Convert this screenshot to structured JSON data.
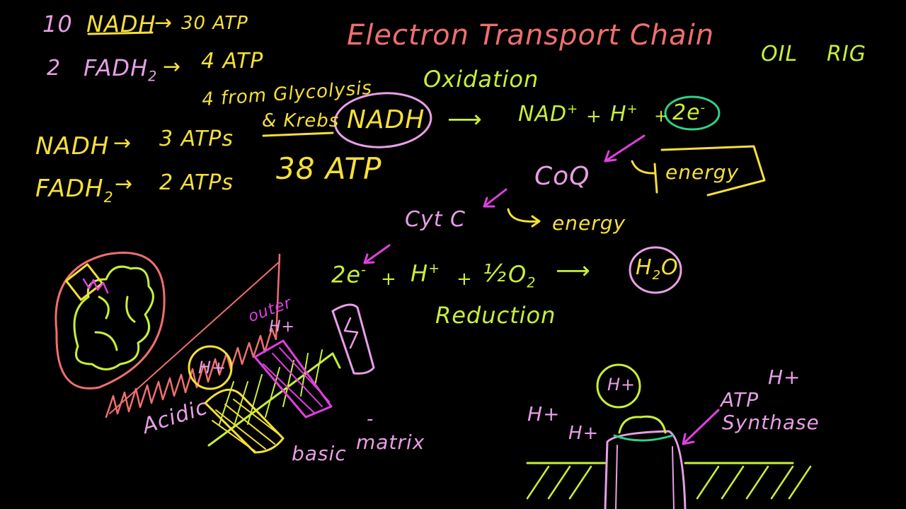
{
  "colors": {
    "yellow": "#f5e03a",
    "pink": "#e79fe6",
    "salmon": "#ef6f70",
    "lime": "#c8ef3a",
    "green": "#2fd18a",
    "magenta": "#e040e0"
  },
  "title": "Electron Transport Chain",
  "mnemonic": {
    "oil": "OIL",
    "rig": "RIG"
  },
  "tally": {
    "nadh_count": "10",
    "nadh": "NADH",
    "nadh_arrow": "→",
    "nadh_atp": "30 ATP",
    "fadh_count": "2",
    "fadh": "FADH",
    "fadh_sub": "2",
    "fadh_arrow": "→",
    "fadh_atp": "4 ATP",
    "from_glycolysis": "4 from Glycolysis",
    "and_krebs": "& Krebs"
  },
  "rates": {
    "nadh_label": "NADH",
    "nadh_arrow": "→",
    "nadh_atp": "3 ATPs",
    "fadh_label": "FADH",
    "fadh_sub": "2",
    "fadh_arrow": "→",
    "fadh_atp": "2 ATPs"
  },
  "total_atp": "38 ATP",
  "oxidation": {
    "label": "Oxidation",
    "reactant": "NADH",
    "arrow": "⟶",
    "p1": "NAD",
    "p1_sup": "+",
    "plus1": "+",
    "p2": "H",
    "p2_sup": "+",
    "plus2": "+",
    "p3": "2e",
    "p3_sup": "-"
  },
  "chain": {
    "coq": "CoQ",
    "cytc": "Cyt C",
    "energy1": "energy",
    "energy2": "energy"
  },
  "reduction": {
    "label": "Reduction",
    "e": "2e",
    "e_sup": "-",
    "plus1": "+",
    "h": "H",
    "h_sup": "+",
    "plus2": "+",
    "half": "½",
    "o": "O",
    "o_sub": "2",
    "arrow": "⟶",
    "product": "H",
    "product_sub": "2",
    "product_o": "O"
  },
  "membrane": {
    "outer": "outer",
    "h_outer": "H+",
    "h_circle": "H+",
    "acidic": "Acidic",
    "basic": "basic",
    "matrix": "matrix",
    "minus": "-"
  },
  "synthase": {
    "h_top": "H+",
    "h_left1": "H+",
    "h_left2": "H+",
    "atp": "ATP",
    "h_right": "H+",
    "name": "Synthase"
  }
}
